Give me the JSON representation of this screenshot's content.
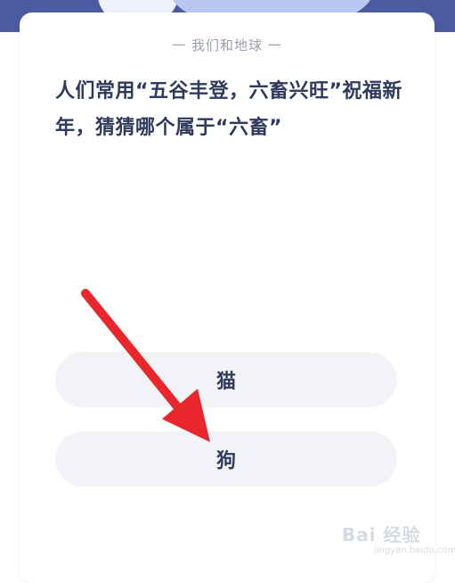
{
  "section": {
    "title": "一 我们和地球 一"
  },
  "question": {
    "text": "人们常用“五谷丰登，六畜兴旺”祝福新年，猜猜哪个属于“六畜”"
  },
  "options": [
    {
      "label": "猫"
    },
    {
      "label": "狗"
    }
  ],
  "watermark": {
    "text": "Bai 经验",
    "sub": "jingyan.baidu.com"
  },
  "colors": {
    "banner": "#4c5ba0",
    "question_text": "#2f3a5c",
    "option_bg": "#f2f3f6",
    "arrow": "#e8262b"
  },
  "annotation": {
    "arrow_icon": "red-arrow-icon"
  }
}
